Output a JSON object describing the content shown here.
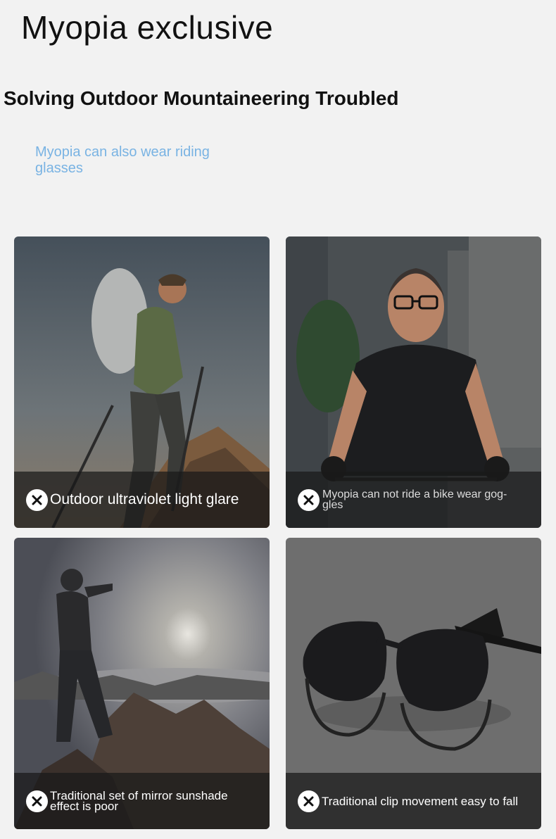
{
  "header": {
    "title": "Myopia exclusive",
    "subtitle": "Solving Outdoor Mountaineering Troubled",
    "note": "Myopia can also wear riding glasses"
  },
  "cards": [
    {
      "caption": "Outdoor ultraviolet light glare",
      "icon": "close-icon",
      "scene": "hiker-with-trekking-poles"
    },
    {
      "caption": "Myopia can not ride a bike wear gog- gles",
      "icon": "close-icon",
      "scene": "man-with-glasses-on-bicycle"
    },
    {
      "caption": "Traditional set of mirror sunshade effect is poor",
      "icon": "close-icon",
      "scene": "hiker-shading-eyes-from-sun"
    },
    {
      "caption": "Traditional clip movement easy to fall",
      "icon": "close-icon",
      "scene": "clip-on-sunglasses"
    }
  ],
  "colors": {
    "background": "#f2f2f2",
    "note": "#79b3e3",
    "caption_bar": "#191919"
  }
}
